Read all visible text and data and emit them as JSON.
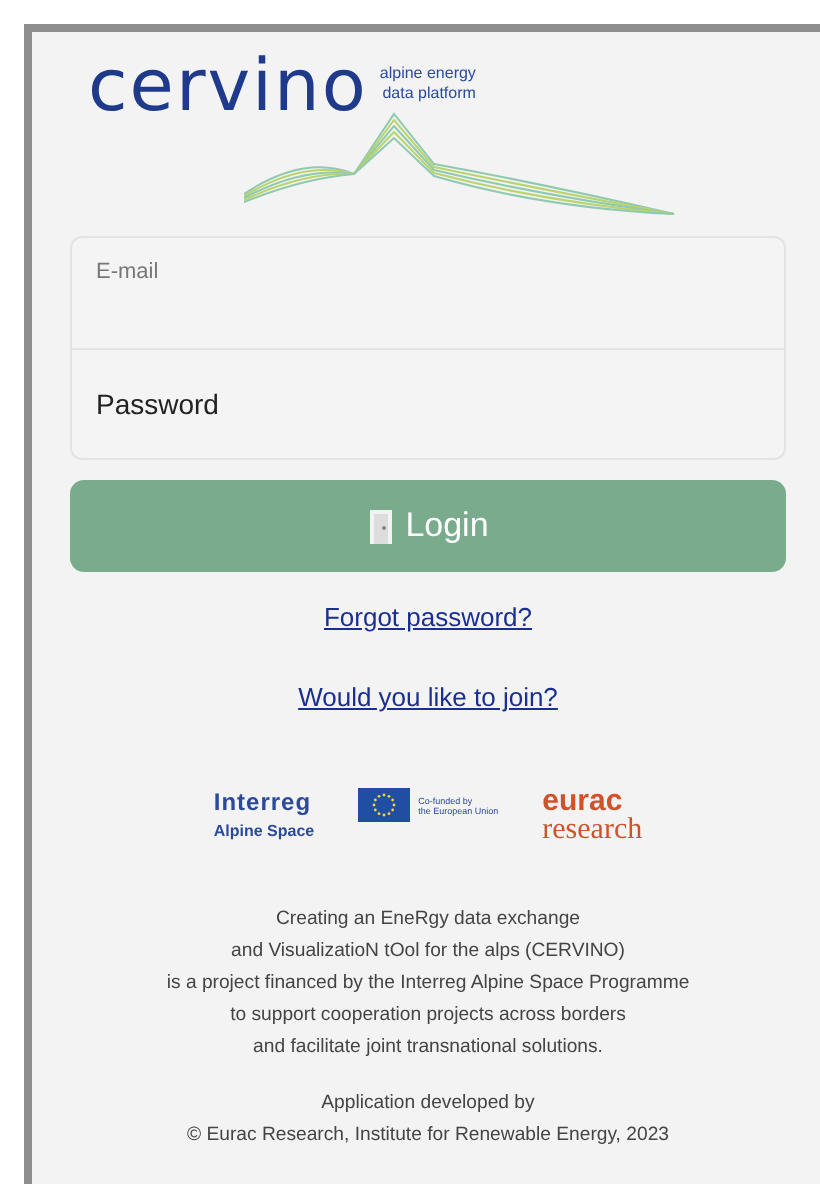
{
  "logo": {
    "name": "cervino",
    "tagline_lines": [
      "alpine energy",
      "data platform"
    ]
  },
  "fields": [
    {
      "placeholder": "E-mail"
    },
    {
      "placeholder": "Password"
    }
  ],
  "login_button": {
    "label": "Login"
  },
  "links": [
    "Forgot password?",
    "Would you like to join?"
  ],
  "partners": {
    "interreg": "Interreg",
    "interreg_sub": "Alpine Space",
    "eu_lines": [
      "Co-funded by",
      "the European Union"
    ],
    "eurac": "eurac",
    "eurac_sub": "research"
  },
  "description_lines": [
    "Creating an EneRgy data exchange",
    "and VisualizatioN tOol for the alps (CERVINO)",
    "is a project financed by the Interreg Alpine Space Programme",
    "to support cooperation projects across borders",
    "and facilitate joint transnational solutions."
  ],
  "credits_lines": [
    "Application developed by",
    "© Eurac Research, Institute for Renewable Energy, 2023"
  ]
}
